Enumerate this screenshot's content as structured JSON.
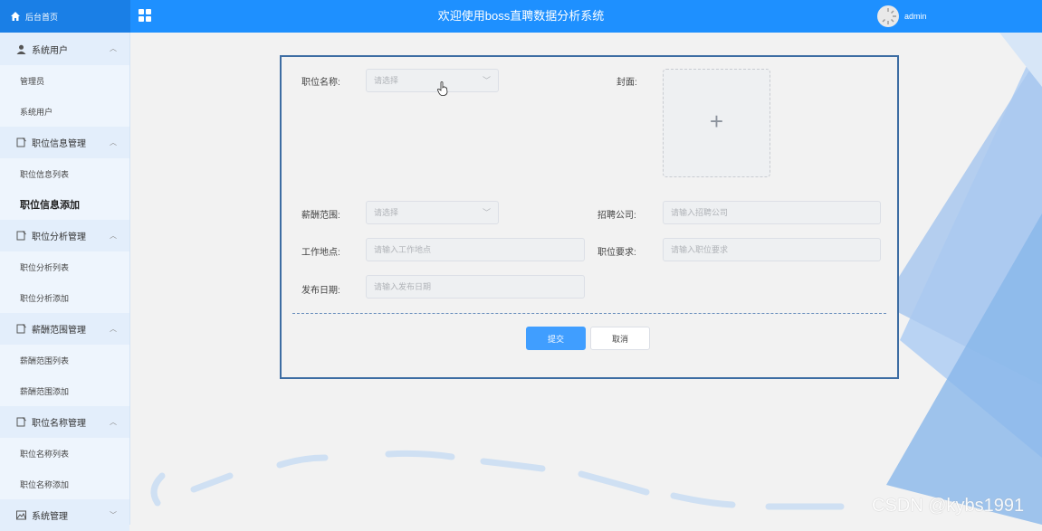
{
  "header": {
    "home_label": "后台首页",
    "title": "欢迎使用boss直聘数据分析系统",
    "username": "admin",
    "brand_color": "#1e90ff"
  },
  "sidebar": {
    "groups": [
      {
        "label": "系统用户",
        "icon": "user-icon",
        "items": [
          "管理员",
          "系统用户"
        ]
      },
      {
        "label": "职位信息管理",
        "icon": "doc-icon",
        "items": [
          "职位信息列表",
          "职位信息添加"
        ]
      },
      {
        "label": "职位分析管理",
        "icon": "doc-icon",
        "items": [
          "职位分析列表",
          "职位分析添加"
        ]
      },
      {
        "label": "薪酬范围管理",
        "icon": "doc-icon",
        "items": [
          "薪酬范围列表",
          "薪酬范围添加"
        ]
      },
      {
        "label": "职位名称管理",
        "icon": "doc-icon",
        "items": [
          "职位名称列表",
          "职位名称添加"
        ]
      },
      {
        "label": "系统管理",
        "icon": "image-icon",
        "items": []
      }
    ],
    "active_item": "职位信息添加"
  },
  "form": {
    "job_name": {
      "label": "职位名称:",
      "placeholder": "请选择"
    },
    "cover": {
      "label": "封面:"
    },
    "salary": {
      "label": "薪酬范围:",
      "placeholder": "请选择"
    },
    "company": {
      "label": "招聘公司:",
      "placeholder": "请输入招聘公司"
    },
    "location": {
      "label": "工作地点:",
      "placeholder": "请输入工作地点"
    },
    "requirement": {
      "label": "职位要求:",
      "placeholder": "请输入职位要求"
    },
    "publish_date": {
      "label": "发布日期:",
      "placeholder": "请输入发布日期"
    },
    "submit_label": "提交",
    "cancel_label": "取消"
  },
  "watermark": "CSDN @kybs1991"
}
